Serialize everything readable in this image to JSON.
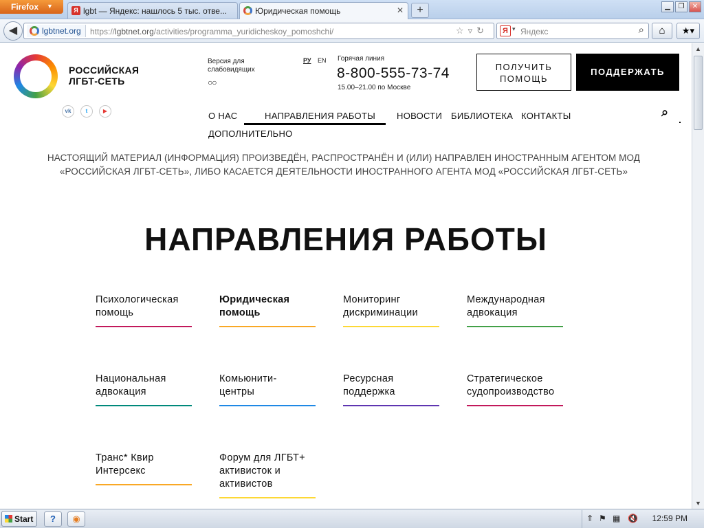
{
  "browser": {
    "menu_label": "Firefox",
    "tabs": [
      {
        "label": "lgbt — Яндекс: нашлось 5 тыс. отве...",
        "active": false
      },
      {
        "label": "Юридическая помощь",
        "active": true
      }
    ],
    "url_site": "lgbtnet.org",
    "url_prefix": "https://",
    "url_domain": "lgbtnet.org",
    "url_path": "/activities/programma_yuridicheskoy_pomoshchi/",
    "search_placeholder": "Яндекс",
    "search_engine_letter": "Я"
  },
  "site": {
    "logo_line1": "РОССИЙСКАЯ",
    "logo_line2": "ЛГБТ-СЕТЬ",
    "social": [
      "vk-icon",
      "twitter-icon",
      "youtube-icon"
    ],
    "vision_line1": "Версия для",
    "vision_line2": "слабовидящих",
    "languages": [
      {
        "code": "РУ",
        "active": true
      },
      {
        "code": "EN",
        "active": false
      }
    ],
    "hotline_label": "Горячая линия",
    "hotline_phone": "8-800-555-73-74",
    "hotline_hours": "15.00–21.00 по Москве",
    "btn_help_line1": "ПОЛУЧИТЬ",
    "btn_help_line2": "ПОМОЩЬ",
    "btn_support": "ПОДДЕРЖАТЬ",
    "nav": {
      "about": "О НАС",
      "directions": "НАПРАВЛЕНИЯ РАБОТЫ",
      "news": "НОВОСТИ",
      "library": "БИБЛИОТЕКА",
      "contacts": "КОНТАКТЫ",
      "more": "ДОПОЛНИТЕЛЬНО"
    },
    "agent_notice_line1": "НАСТОЯЩИЙ МАТЕРИАЛ (ИНФОРМАЦИЯ) ПРОИЗВЕДЁН, РАСПРОСТРАНЁН И (ИЛИ) НАПРАВЛЕН ИНОСТРАННЫМ АГЕНТОМ МОД",
    "agent_notice_line2": "«РОССИЙСКАЯ ЛГБТ-СЕТЬ», ЛИБО КАСАЕТСЯ ДЕЯТЕЛЬНОСТИ ИНОСТРАННОГО АГЕНТА МОД «РОССИЙСКАЯ ЛГБТ-СЕТЬ»",
    "page_title": "НАПРАВЛЕНИЯ РАБОТЫ",
    "directions": [
      {
        "line1": "Психологическая",
        "line2": "помощь",
        "line3": "",
        "color": "#c2185b",
        "active": false
      },
      {
        "line1": "Юридическая",
        "line2": "помощь",
        "line3": "",
        "color": "#f9a825",
        "active": true
      },
      {
        "line1": "Мониторинг",
        "line2": "дискриминации",
        "line3": "",
        "color": "#fdd835",
        "active": false
      },
      {
        "line1": "Международная",
        "line2": "адвокация",
        "line3": "",
        "color": "#43a047",
        "active": false
      },
      {
        "line1": "Национальная",
        "line2": "адвокация",
        "line3": "",
        "color": "#00897b",
        "active": false
      },
      {
        "line1": "Комьюнити-",
        "line2": "центры",
        "line3": "",
        "color": "#1e88e5",
        "active": false
      },
      {
        "line1": "Ресурсная",
        "line2": "поддержка",
        "line3": "",
        "color": "#5e35b1",
        "active": false
      },
      {
        "line1": "Стратегическое",
        "line2": "судопроизводство",
        "line3": "",
        "color": "#c2185b",
        "active": false
      },
      {
        "line1": "Транс* Квир",
        "line2": "Интерсекс",
        "line3": "",
        "color": "#f9a825",
        "active": false
      },
      {
        "line1": "Форум для ЛГБТ+",
        "line2": "активисток и",
        "line3": "активистов",
        "color": "#fdd835",
        "active": false
      }
    ]
  },
  "taskbar": {
    "start_label": "Start",
    "clock": "12:59 PM"
  }
}
